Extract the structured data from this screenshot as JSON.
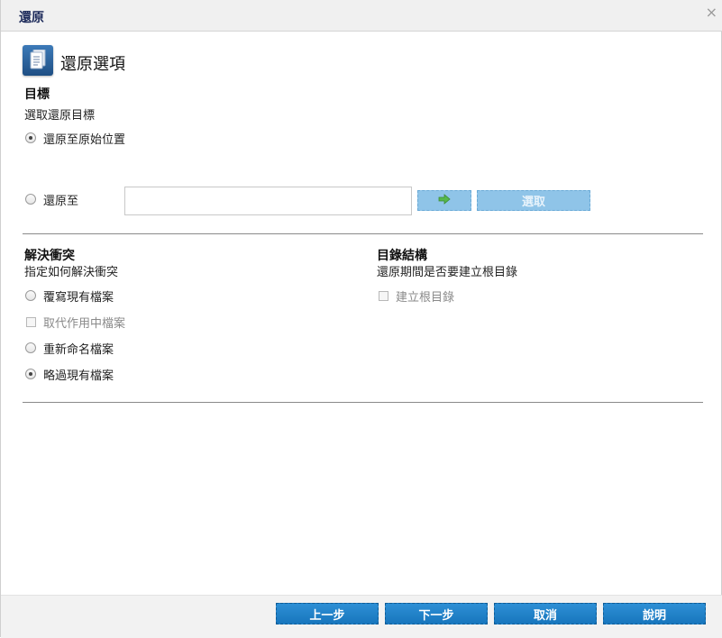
{
  "window": {
    "title": "還原",
    "close_glyph": "×"
  },
  "header": {
    "title": "還原選項",
    "icon": "document-icon"
  },
  "destination": {
    "title": "目標",
    "subtitle": "選取還原目標",
    "option_original": "還原至原始位置",
    "option_original_checked": true,
    "option_alternate": "還原至",
    "option_alternate_checked": false,
    "path_value": "",
    "browse_label": "選取"
  },
  "conflict": {
    "title": "解決衝突",
    "subtitle": "指定如何解決衝突",
    "options": [
      {
        "label": "覆寫現有檔案",
        "type": "radio",
        "checked": false,
        "enabled": true
      },
      {
        "label": "取代作用中檔案",
        "type": "checkbox",
        "checked": false,
        "enabled": false
      },
      {
        "label": "重新命名檔案",
        "type": "radio",
        "checked": false,
        "enabled": true
      },
      {
        "label": "略過現有檔案",
        "type": "radio",
        "checked": true,
        "enabled": true
      }
    ]
  },
  "directory": {
    "title": "目錄結構",
    "subtitle": "還原期間是否要建立根目錄",
    "create_root_label": "建立根目錄",
    "create_root_checked": false,
    "create_root_enabled": false
  },
  "footer": {
    "prev_label": "上一步",
    "next_label": "下一步",
    "cancel_label": "取消",
    "help_label": "說明"
  },
  "colors": {
    "title": "#1c2a5a",
    "button": "#1f80c8",
    "button_disabled": "#8fc4e8"
  }
}
